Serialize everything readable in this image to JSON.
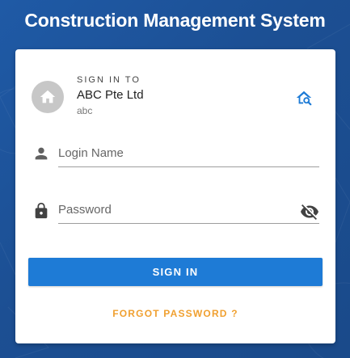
{
  "header": {
    "title": "Construction Management System"
  },
  "company": {
    "signin_to_label": "SIGN IN TO",
    "name": "ABC Pte Ltd",
    "code": "abc",
    "avatar_icon": "home-icon",
    "find_icon": "home-search-icon"
  },
  "form": {
    "login_name": {
      "placeholder": "Login Name",
      "value": "",
      "icon": "person-icon"
    },
    "password": {
      "placeholder": "Password",
      "value": "",
      "icon": "lock-icon",
      "toggle_icon": "eye-off-icon"
    },
    "signin_label": "SIGN IN",
    "forgot_label": "FORGOT PASSWORD ?"
  },
  "colors": {
    "background": "#1c4f93",
    "primary_button": "#1e7bd6",
    "forgot_link": "#f0a030",
    "find_icon": "#1e7bd6"
  }
}
